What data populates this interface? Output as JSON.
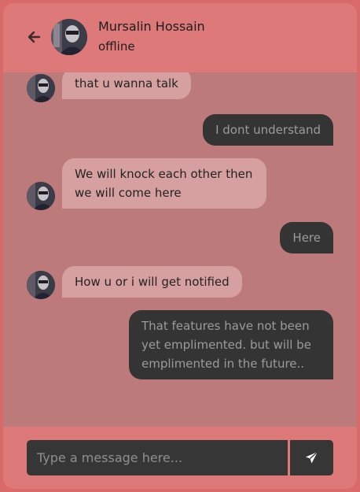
{
  "contact": {
    "name": "Mursalin Hossain",
    "status": "offline"
  },
  "messages": [
    {
      "direction": "in",
      "text": "that u wanna talk"
    },
    {
      "direction": "out",
      "text": "I dont understand"
    },
    {
      "direction": "in",
      "text": "We will knock each other then we will come here"
    },
    {
      "direction": "out",
      "text": "Here"
    },
    {
      "direction": "in",
      "text": "How u or i will get notified"
    },
    {
      "direction": "out",
      "text": "That features have not been yet emplimented. but will be emplimented in the future.."
    }
  ],
  "composer": {
    "placeholder": "Type a message here..."
  },
  "icons": {
    "back": "arrow-left-icon",
    "send": "paper-plane-icon"
  },
  "colors": {
    "header": "#de7979",
    "chat_area": "#bd7a7a",
    "incoming_bubble": "#d7a0a0",
    "outgoing_bubble": "#343434"
  }
}
